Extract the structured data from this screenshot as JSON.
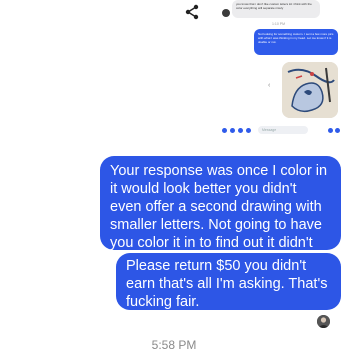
{
  "top": {
    "share_icon": "share-icon",
    "quoted_gray_text": "you know that i don't like custom letters lol i think with the color everything will separate nicely",
    "quoted_time": "1:10 PM",
    "quoted_blue_text": "Not looking for something custom. I sent a few more pics with what I was thinking in my head. Let me know if it is doable or not.",
    "quoted_input_placeholder": "Message"
  },
  "messages": [
    {
      "text": "Your response was once I color in it would look better you didn't even offer a second drawing with smaller letters. Not going to have you color it in to find out it didn't separate nicely."
    },
    {
      "text": "Please return $50 you didn't earn that's all I'm asking. That's fucking fair."
    }
  ],
  "footer": {
    "timestamp": "5:58 PM"
  },
  "colors": {
    "bubble": "#2d56e6",
    "background": "#ffffff"
  }
}
